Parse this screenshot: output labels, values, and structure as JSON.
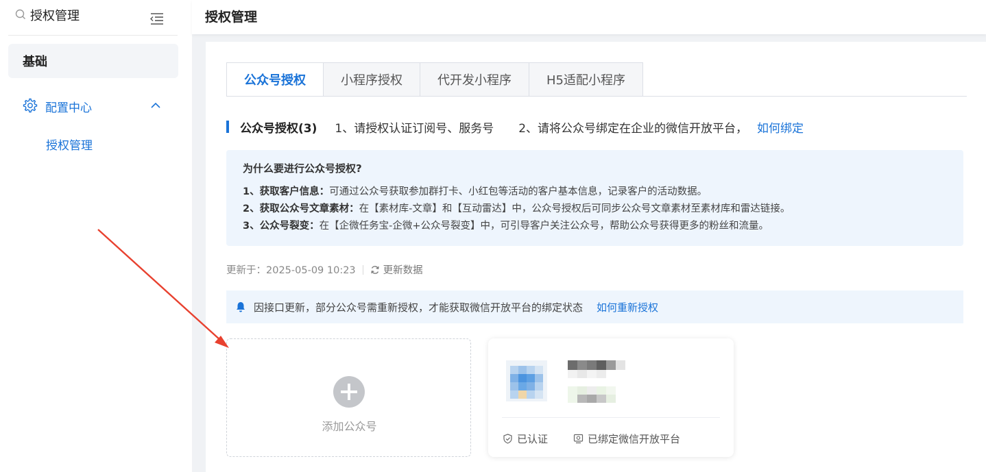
{
  "sidebar": {
    "search": {
      "value": "授权管理",
      "icon": "search-icon"
    },
    "group_label": "基础",
    "menu": {
      "label": "配置中心",
      "icon": "gear-icon",
      "expanded": true
    },
    "submenu": {
      "label": "授权管理"
    }
  },
  "header": {
    "title": "授权管理"
  },
  "tabs": [
    {
      "label": "公众号授权",
      "active": true
    },
    {
      "label": "小程序授权",
      "active": false
    },
    {
      "label": "代开发小程序",
      "active": false
    },
    {
      "label": "H5适配小程序",
      "active": false
    }
  ],
  "section": {
    "title": "公众号授权(3)",
    "tip1": "1、请授权认证订阅号、服务号",
    "tip2": "2、请将公众号绑定在企业的微信开放平台，",
    "link": "如何绑定"
  },
  "info": {
    "title": "为什么要进行公众号授权?",
    "items": [
      {
        "bold": "1、获取客户信息：",
        "text": "可通过公众号获取参加群打卡、小红包等活动的客户基本信息，记录客户的活动数据。"
      },
      {
        "bold": "2、获取公众号文章素材：",
        "text": "在【素材库-文章】和【互动雷达】中，公众号授权后可同步公众号文章素材至素材库和雷达链接。"
      },
      {
        "bold": "3、公众号裂变：",
        "text": "在【企微任务宝-企微+公众号裂变】中，可引导客户关注公众号，帮助公众号获得更多的粉丝和流量。"
      }
    ]
  },
  "update": {
    "label": "更新于：2025-05-09 10:23",
    "refresh": "更新数据"
  },
  "notice": {
    "text": "因接口更新，部分公众号需重新授权，才能获取微信开放平台的绑定状态",
    "link": "如何重新授权"
  },
  "add_card": {
    "label": "添加公众号"
  },
  "account_card": {
    "status_verified": "已认证",
    "status_bound": "已绑定微信开放平台"
  },
  "colors": {
    "accent": "#1a73d8",
    "annotation_arrow": "#e8412f"
  }
}
